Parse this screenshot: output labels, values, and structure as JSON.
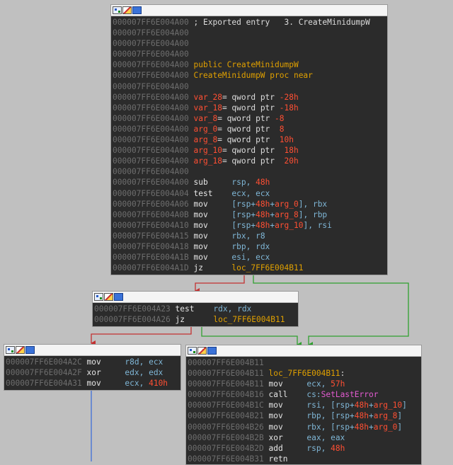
{
  "node_main": {
    "lines": [
      [
        {
          "c": "ad",
          "t": "000007FF6E004A00 "
        },
        {
          "c": "wt",
          "t": "; Exported entry   3. CreateMinidumpW"
        }
      ],
      [
        {
          "c": "ad",
          "t": "000007FF6E004A00"
        }
      ],
      [
        {
          "c": "ad",
          "t": "000007FF6E004A00"
        }
      ],
      [
        {
          "c": "ad",
          "t": "000007FF6E004A00"
        }
      ],
      [
        {
          "c": "ad",
          "t": "000007FF6E004A00 "
        },
        {
          "c": "pm",
          "t": "public CreateMinidumpW"
        }
      ],
      [
        {
          "c": "ad",
          "t": "000007FF6E004A00 "
        },
        {
          "c": "pm",
          "t": "CreateMinidumpW proc near"
        }
      ],
      [
        {
          "c": "ad",
          "t": "000007FF6E004A00"
        }
      ],
      [
        {
          "c": "ad",
          "t": "000007FF6E004A00 "
        },
        {
          "c": "vr",
          "t": "var_28"
        },
        {
          "c": "wt",
          "t": "= qword ptr "
        },
        {
          "c": "nm",
          "t": "-28h"
        }
      ],
      [
        {
          "c": "ad",
          "t": "000007FF6E004A00 "
        },
        {
          "c": "vr",
          "t": "var_18"
        },
        {
          "c": "wt",
          "t": "= qword ptr "
        },
        {
          "c": "nm",
          "t": "-18h"
        }
      ],
      [
        {
          "c": "ad",
          "t": "000007FF6E004A00 "
        },
        {
          "c": "vr",
          "t": "var_8"
        },
        {
          "c": "wt",
          "t": "= qword ptr "
        },
        {
          "c": "nm",
          "t": "-8"
        }
      ],
      [
        {
          "c": "ad",
          "t": "000007FF6E004A00 "
        },
        {
          "c": "vr",
          "t": "arg_0"
        },
        {
          "c": "wt",
          "t": "= qword ptr  "
        },
        {
          "c": "nm",
          "t": "8"
        }
      ],
      [
        {
          "c": "ad",
          "t": "000007FF6E004A00 "
        },
        {
          "c": "vr",
          "t": "arg_8"
        },
        {
          "c": "wt",
          "t": "= qword ptr  "
        },
        {
          "c": "nm",
          "t": "10h"
        }
      ],
      [
        {
          "c": "ad",
          "t": "000007FF6E004A00 "
        },
        {
          "c": "vr",
          "t": "arg_10"
        },
        {
          "c": "wt",
          "t": "= qword ptr  "
        },
        {
          "c": "nm",
          "t": "18h"
        }
      ],
      [
        {
          "c": "ad",
          "t": "000007FF6E004A00 "
        },
        {
          "c": "vr",
          "t": "arg_18"
        },
        {
          "c": "wt",
          "t": "= qword ptr  "
        },
        {
          "c": "nm",
          "t": "20h"
        }
      ],
      [
        {
          "c": "ad",
          "t": "000007FF6E004A00"
        }
      ],
      [
        {
          "c": "ad",
          "t": "000007FF6E004A00 "
        },
        {
          "c": "mn",
          "t": "sub     "
        },
        {
          "c": "op",
          "t": "rsp, "
        },
        {
          "c": "nm",
          "t": "48h"
        }
      ],
      [
        {
          "c": "ad",
          "t": "000007FF6E004A04 "
        },
        {
          "c": "mn",
          "t": "test    "
        },
        {
          "c": "op",
          "t": "ecx, ecx"
        }
      ],
      [
        {
          "c": "ad",
          "t": "000007FF6E004A06 "
        },
        {
          "c": "mn",
          "t": "mov     "
        },
        {
          "c": "op",
          "t": "[rsp+"
        },
        {
          "c": "nm",
          "t": "48h"
        },
        {
          "c": "op",
          "t": "+"
        },
        {
          "c": "vr",
          "t": "arg_0"
        },
        {
          "c": "op",
          "t": "], rbx"
        }
      ],
      [
        {
          "c": "ad",
          "t": "000007FF6E004A0B "
        },
        {
          "c": "mn",
          "t": "mov     "
        },
        {
          "c": "op",
          "t": "[rsp+"
        },
        {
          "c": "nm",
          "t": "48h"
        },
        {
          "c": "op",
          "t": "+"
        },
        {
          "c": "vr",
          "t": "arg_8"
        },
        {
          "c": "op",
          "t": "], rbp"
        }
      ],
      [
        {
          "c": "ad",
          "t": "000007FF6E004A10 "
        },
        {
          "c": "mn",
          "t": "mov     "
        },
        {
          "c": "op",
          "t": "[rsp+"
        },
        {
          "c": "nm",
          "t": "48h"
        },
        {
          "c": "op",
          "t": "+"
        },
        {
          "c": "vr",
          "t": "arg_10"
        },
        {
          "c": "op",
          "t": "], rsi"
        }
      ],
      [
        {
          "c": "ad",
          "t": "000007FF6E004A15 "
        },
        {
          "c": "mn",
          "t": "mov     "
        },
        {
          "c": "op",
          "t": "rbx, r8"
        }
      ],
      [
        {
          "c": "ad",
          "t": "000007FF6E004A18 "
        },
        {
          "c": "mn",
          "t": "mov     "
        },
        {
          "c": "op",
          "t": "rbp, rdx"
        }
      ],
      [
        {
          "c": "ad",
          "t": "000007FF6E004A1B "
        },
        {
          "c": "mn",
          "t": "mov     "
        },
        {
          "c": "op",
          "t": "esi, ecx"
        }
      ],
      [
        {
          "c": "ad",
          "t": "000007FF6E004A1D "
        },
        {
          "c": "mn",
          "t": "jz      "
        },
        {
          "c": "lb",
          "t": "loc_7FF6E004B11"
        }
      ]
    ]
  },
  "node_test": {
    "lines": [
      [
        {
          "c": "ad",
          "t": "000007FF6E004A23 "
        },
        {
          "c": "mn",
          "t": "test    "
        },
        {
          "c": "op",
          "t": "rdx, rdx"
        }
      ],
      [
        {
          "c": "ad",
          "t": "000007FF6E004A26 "
        },
        {
          "c": "mn",
          "t": "jz      "
        },
        {
          "c": "lb",
          "t": "loc_7FF6E004B11"
        }
      ]
    ]
  },
  "node_left": {
    "lines": [
      [
        {
          "c": "ad",
          "t": "000007FF6E004A2C "
        },
        {
          "c": "mn",
          "t": "mov     "
        },
        {
          "c": "op",
          "t": "r8d, ecx"
        }
      ],
      [
        {
          "c": "ad",
          "t": "000007FF6E004A2F "
        },
        {
          "c": "mn",
          "t": "xor     "
        },
        {
          "c": "op",
          "t": "edx, edx"
        }
      ],
      [
        {
          "c": "ad",
          "t": "000007FF6E004A31 "
        },
        {
          "c": "mn",
          "t": "mov     "
        },
        {
          "c": "op",
          "t": "ecx, "
        },
        {
          "c": "nm",
          "t": "410h"
        }
      ]
    ]
  },
  "node_b11": {
    "lines": [
      [
        {
          "c": "ad",
          "t": "000007FF6E004B11"
        }
      ],
      [
        {
          "c": "ad",
          "t": "000007FF6E004B11 "
        },
        {
          "c": "lb",
          "t": "loc_7FF6E004B11"
        },
        {
          "c": "wt",
          "t": ":"
        }
      ],
      [
        {
          "c": "ad",
          "t": "000007FF6E004B11 "
        },
        {
          "c": "mn",
          "t": "mov     "
        },
        {
          "c": "op",
          "t": "ecx, "
        },
        {
          "c": "nm",
          "t": "57h"
        }
      ],
      [
        {
          "c": "ad",
          "t": "000007FF6E004B16 "
        },
        {
          "c": "mn",
          "t": "call    "
        },
        {
          "c": "op",
          "t": "cs:"
        },
        {
          "c": "mg",
          "t": "SetLastError"
        }
      ],
      [
        {
          "c": "ad",
          "t": "000007FF6E004B1C "
        },
        {
          "c": "mn",
          "t": "mov     "
        },
        {
          "c": "op",
          "t": "rsi, [rsp+"
        },
        {
          "c": "nm",
          "t": "48h"
        },
        {
          "c": "op",
          "t": "+"
        },
        {
          "c": "vr",
          "t": "arg_10"
        },
        {
          "c": "op",
          "t": "]"
        }
      ],
      [
        {
          "c": "ad",
          "t": "000007FF6E004B21 "
        },
        {
          "c": "mn",
          "t": "mov     "
        },
        {
          "c": "op",
          "t": "rbp, [rsp+"
        },
        {
          "c": "nm",
          "t": "48h"
        },
        {
          "c": "op",
          "t": "+"
        },
        {
          "c": "vr",
          "t": "arg_8"
        },
        {
          "c": "op",
          "t": "]"
        }
      ],
      [
        {
          "c": "ad",
          "t": "000007FF6E004B26 "
        },
        {
          "c": "mn",
          "t": "mov     "
        },
        {
          "c": "op",
          "t": "rbx, [rsp+"
        },
        {
          "c": "nm",
          "t": "48h"
        },
        {
          "c": "op",
          "t": "+"
        },
        {
          "c": "vr",
          "t": "arg_0"
        },
        {
          "c": "op",
          "t": "]"
        }
      ],
      [
        {
          "c": "ad",
          "t": "000007FF6E004B2B "
        },
        {
          "c": "mn",
          "t": "xor     "
        },
        {
          "c": "op",
          "t": "eax, eax"
        }
      ],
      [
        {
          "c": "ad",
          "t": "000007FF6E004B2D "
        },
        {
          "c": "mn",
          "t": "add     "
        },
        {
          "c": "op",
          "t": "rsp, "
        },
        {
          "c": "nm",
          "t": "48h"
        }
      ],
      [
        {
          "c": "ad",
          "t": "000007FF6E004B31 "
        },
        {
          "c": "mn",
          "t": "retn"
        }
      ]
    ]
  },
  "colors": {
    "edge_false": "#c43131",
    "edge_true": "#2fa12f",
    "edge_flow": "#3f6ed8",
    "canvas": "#c0c0c0",
    "node_bg": "#2b2b2b"
  }
}
